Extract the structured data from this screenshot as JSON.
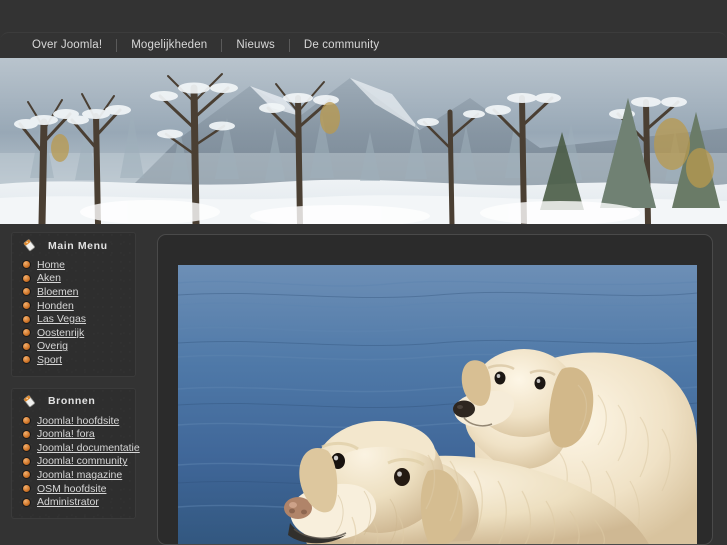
{
  "site": {
    "title": "Joomla! Site",
    "background_color": "#333333",
    "module_background": "#2e2e2e",
    "link_color": "#d6d6d6",
    "bullet_color": "#d4792c",
    "content_panel_color": "#2b2b2b"
  },
  "topnav": {
    "items": [
      {
        "label": "Over Joomla!"
      },
      {
        "label": "Mogelijkheden"
      },
      {
        "label": "Nieuws"
      },
      {
        "label": "De community"
      }
    ]
  },
  "banner": {
    "alt": "Snowy winter forest landscape with snow covered trees and mountains"
  },
  "sidebar": {
    "modules": [
      {
        "title": "Main Menu",
        "icon": "tag-icon",
        "items": [
          {
            "label": "Home"
          },
          {
            "label": "Aken"
          },
          {
            "label": "Bloemen"
          },
          {
            "label": "Honden"
          },
          {
            "label": "Las Vegas"
          },
          {
            "label": "Oostenrijk"
          },
          {
            "label": "Overig"
          },
          {
            "label": "Sport"
          }
        ]
      },
      {
        "title": "Bronnen",
        "icon": "tag-icon",
        "items": [
          {
            "label": "Joomla! hoofdsite"
          },
          {
            "label": "Joomla! fora"
          },
          {
            "label": "Joomla! documentatie"
          },
          {
            "label": "Joomla! community"
          },
          {
            "label": "Joomla! magazine"
          },
          {
            "label": "OSM hoofdsite"
          },
          {
            "label": "Administrator"
          }
        ]
      }
    ]
  },
  "content": {
    "image_alt": "Two golden retriever dogs in blue water"
  }
}
